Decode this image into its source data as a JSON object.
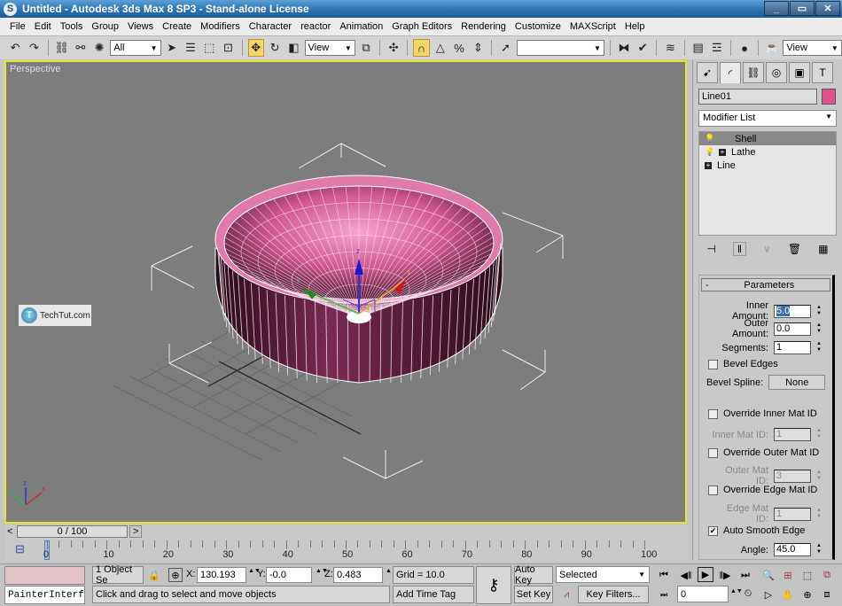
{
  "window": {
    "title": "Untitled - Autodesk 3ds Max 8 SP3  - Stand-alone License",
    "app_icon": "3ds-max-icon",
    "controls": [
      "minimize",
      "restore",
      "close"
    ]
  },
  "menu": [
    "File",
    "Edit",
    "Tools",
    "Group",
    "Views",
    "Create",
    "Modifiers",
    "Character",
    "reactor",
    "Animation",
    "Graph Editors",
    "Rendering",
    "Customize",
    "MAXScript",
    "Help"
  ],
  "toolbar": {
    "selection_filter": "All",
    "ref_coord": "View",
    "named_selection": "",
    "render_view": "View"
  },
  "viewport": {
    "label": "Perspective",
    "watermark": "TechTut.com",
    "axis_labels": {
      "x": "x",
      "y": "y",
      "z": "z"
    }
  },
  "command_panel": {
    "object_name": "Line01",
    "object_color": "#e0508c",
    "modifier_list": "Modifier List",
    "stack": [
      {
        "label": "Shell",
        "selected": true,
        "bulb": true,
        "plus": false
      },
      {
        "label": "Lathe",
        "selected": false,
        "bulb": true,
        "plus": true
      },
      {
        "label": "Line",
        "selected": false,
        "bulb": false,
        "plus": true
      }
    ],
    "rollout": {
      "title": "Parameters",
      "collapse": "-",
      "inner_amount_label": "Inner Amount:",
      "inner_amount": "5.0",
      "outer_amount_label": "Outer Amount:",
      "outer_amount": "0.0",
      "segments_label": "Segments:",
      "segments": "1",
      "bevel_edges_label": "Bevel Edges",
      "bevel_edges": false,
      "bevel_spline_label": "Bevel Spline:",
      "bevel_spline": "None",
      "override_inner_label": "Override Inner Mat ID",
      "override_inner": false,
      "inner_mat_label": "Inner Mat ID:",
      "inner_mat": "1",
      "override_outer_label": "Override Outer Mat ID",
      "override_outer": false,
      "outer_mat_label": "Outer Mat ID:",
      "outer_mat": "3",
      "override_edge_label": "Override Edge Mat ID",
      "override_edge": false,
      "edge_mat_label": "Edge Mat ID:",
      "edge_mat": "1",
      "auto_smooth_label": "Auto Smooth Edge",
      "auto_smooth": true,
      "angle_label": "Angle:",
      "angle": "45.0"
    }
  },
  "timeline": {
    "slider": "0 / 100",
    "prev": "<",
    "next": ">",
    "ticks": [
      "0",
      "10",
      "20",
      "30",
      "40",
      "50",
      "60",
      "70",
      "80",
      "90",
      "100"
    ]
  },
  "status": {
    "maxscript_listener": "PainterInterf",
    "selection": "1 Object Se",
    "x_label": "X:",
    "x": "130.193",
    "y_label": "Y:",
    "y": "-0.0",
    "z_label": "Z:",
    "z": "0.483",
    "grid": "Grid = 10.0",
    "prompt": "Click and drag to select and move objects",
    "add_time_tag": "Add Time Tag",
    "auto_key": "Auto Key",
    "set_key": "Set Key",
    "key_mode": "Selected",
    "key_filters": "Key Filters...",
    "current_frame": "0"
  }
}
